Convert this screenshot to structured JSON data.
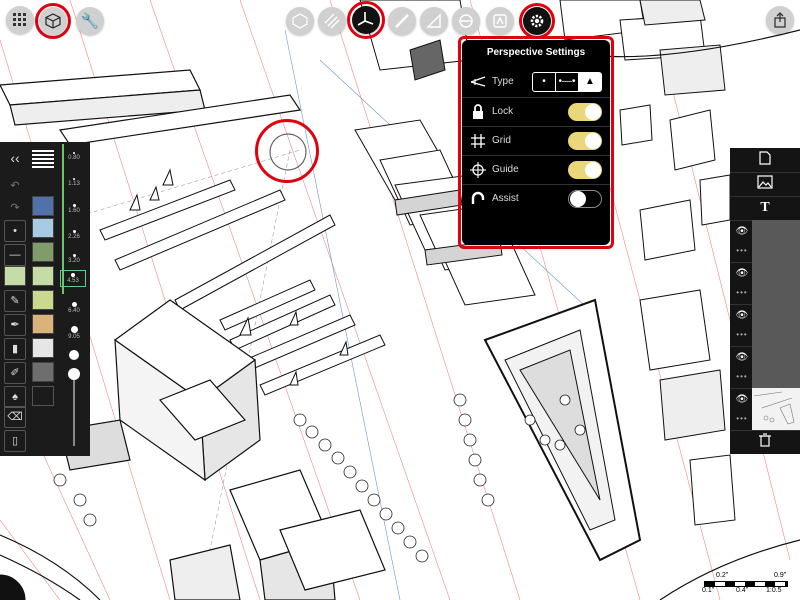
{
  "toolbar_left": {
    "grid_icon": "grid-icon",
    "cube_icon": "cube-icon",
    "wrench_icon": "wrench-icon"
  },
  "toolbar_center": {
    "icons": [
      "sphere-icon",
      "hatch-icon",
      "perspective-axes-icon",
      "ruler-icon",
      "set-square-icon",
      "ellipse-icon",
      "stencil-icon",
      "gear-icon"
    ]
  },
  "toolbar_right": {
    "share_icon": "share-icon"
  },
  "perspective": {
    "title": "Perspective Settings",
    "rows": [
      {
        "label": "Type",
        "icon": "vanishing-point-icon",
        "options": [
          "•",
          "•—•",
          "▲"
        ],
        "selected": 2
      },
      {
        "label": "Lock",
        "icon": "lock-icon",
        "state": "on"
      },
      {
        "label": "Grid",
        "icon": "grid-hash-icon",
        "state": "on"
      },
      {
        "label": "Guide",
        "icon": "guide-icon",
        "state": "on"
      },
      {
        "label": "Assist",
        "icon": "magnet-icon",
        "state": "off"
      }
    ]
  },
  "left_palette": {
    "collapse": "‹‹",
    "brush_sizes": [
      "0.80",
      "1.13",
      "1.60",
      "2.26",
      "3.20",
      "4.53",
      "6.40",
      "9.05"
    ],
    "selected_size": "4.53",
    "colors": [
      "#4f73a9",
      "#a7cbe5",
      "#809c6b",
      "#c6dca6",
      "#cbd98e",
      "#d9b37a",
      "#e6e6e6",
      "#6e6e6e",
      "#1b1b1b"
    ]
  },
  "layers_panel": {
    "text_tool": "T",
    "layer_count": 5
  },
  "scale_bar": {
    "top_labels": [
      "0.2\"",
      "0.9\""
    ],
    "bottom_labels": [
      "0.1\"",
      "0.4\"",
      "1:0.5"
    ]
  },
  "colors": {
    "highlight": "#e10010",
    "toggle_on": "#e9d77a"
  }
}
